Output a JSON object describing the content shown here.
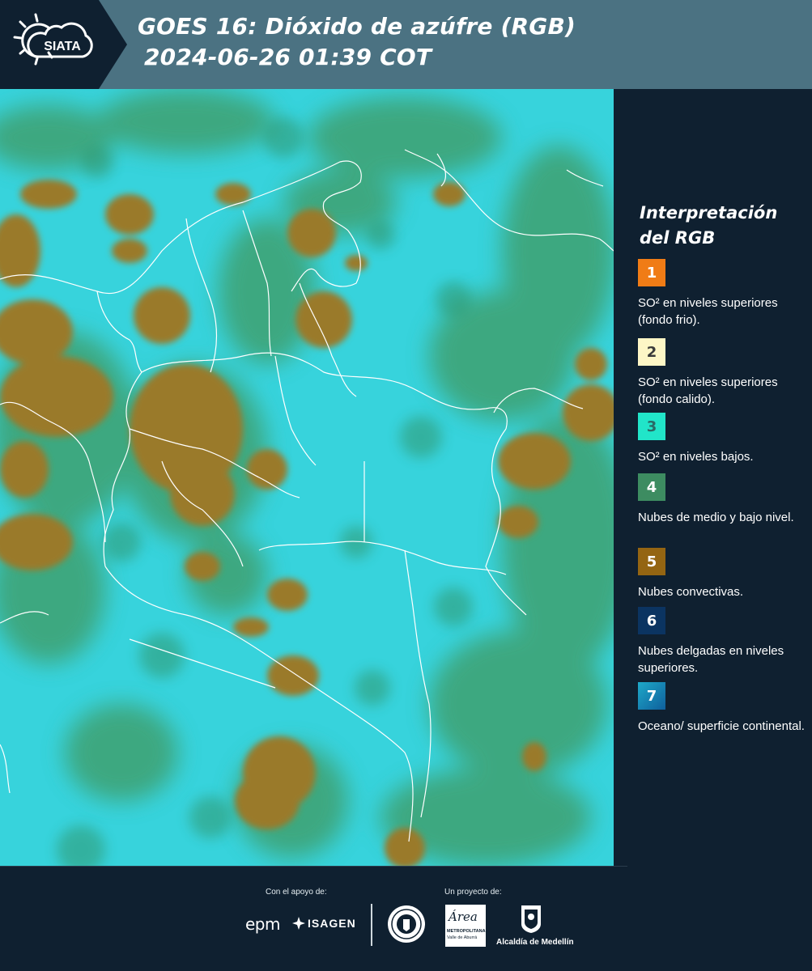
{
  "header": {
    "brand": "SIATA",
    "title_line1": "GOES 16: Dióxido de azúfre (RGB)",
    "title_line2": "2024-06-26 01:39 COT"
  },
  "legend": {
    "title": "Interpretación del RGB",
    "items": [
      {
        "num": "1",
        "color": "#f07c16",
        "num_color": "#ffffff",
        "text": "SO² en niveles superiores (fondo frio)."
      },
      {
        "num": "2",
        "color": "#fdf6c6",
        "num_color": "#3a3a3a",
        "text": "SO² en niveles superiores (fondo calido)."
      },
      {
        "num": "3",
        "color": "#21e5c9",
        "num_color": "#2a6a66",
        "text": "SO² en niveles bajos."
      },
      {
        "num": "4",
        "color": "#3d8c61",
        "num_color": "#ffffff",
        "text": "Nubes de medio y bajo nivel."
      },
      {
        "num": "5",
        "color": "#946512",
        "num_color": "#ffffff",
        "text": "Nubes convectivas."
      },
      {
        "num": "6",
        "color": "#0b3461",
        "num_color": "#ffffff",
        "text": "Nubes delgadas en niveles superiores."
      },
      {
        "num": "7",
        "color": "#1a8cb8",
        "num_color": "#ffffff",
        "text": "Oceano/ superficie continental."
      }
    ]
  },
  "colors": {
    "map_cyan": "#37d3dc",
    "map_green": "#3f9a62",
    "map_brown": "#9a7a2a",
    "header_band": "#4b7282",
    "background": "#0f2030"
  },
  "footer": {
    "support_label": "Con el apoyo de:",
    "project_label": "Un proyecto de:",
    "epm": "epm",
    "isagen": "ISAGEN",
    "area_metro": "Área",
    "area_metro_sub": "METROPOLITANA",
    "area_metro_sub2": "Valle de Aburrá",
    "alcaldia": "Alcaldía de Medellín"
  }
}
